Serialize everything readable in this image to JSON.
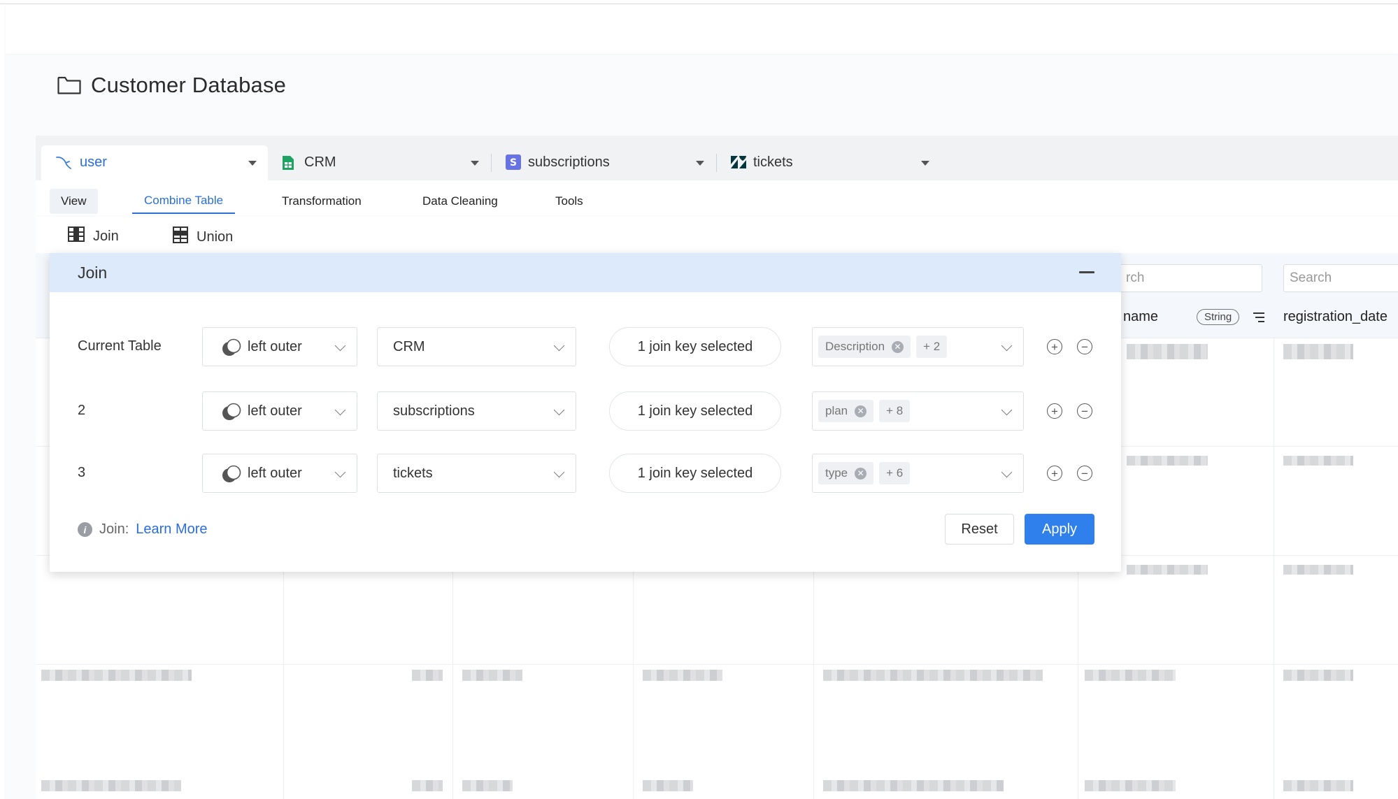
{
  "page": {
    "title": "Customer Database",
    "icon": "folder-icon"
  },
  "source_tabs": [
    {
      "label": "user",
      "icon": "mysql-icon",
      "active": true
    },
    {
      "label": "CRM",
      "icon": "google-sheets-icon",
      "active": false
    },
    {
      "label": "subscriptions",
      "icon": "stripe-icon",
      "active": false
    },
    {
      "label": "tickets",
      "icon": "zendesk-icon",
      "active": false
    }
  ],
  "menu_tabs": [
    {
      "label": "View"
    },
    {
      "label": "Combine Table",
      "active": true
    },
    {
      "label": "Transformation"
    },
    {
      "label": "Data Cleaning"
    },
    {
      "label": "Tools"
    }
  ],
  "tools": {
    "join_label": "Join",
    "union_label": "Union"
  },
  "grid": {
    "search_partial": "rch",
    "search_placeholder": "Search",
    "columns": [
      {
        "name": "name",
        "type_badge": "String"
      },
      {
        "name": "registration_date"
      }
    ]
  },
  "join_panel": {
    "title": "Join",
    "rows": [
      {
        "label": "Current Table",
        "join_type": "left outer",
        "table": "CRM",
        "keys": "1 join key selected",
        "first_column": "Description",
        "more_columns": "+ 2"
      },
      {
        "label": "2",
        "join_type": "left outer",
        "table": "subscriptions",
        "keys": "1 join key selected",
        "first_column": "plan",
        "more_columns": "+ 8"
      },
      {
        "label": "3",
        "join_type": "left outer",
        "table": "tickets",
        "keys": "1 join key selected",
        "first_column": "type",
        "more_columns": "+ 6"
      }
    ],
    "footer_prefix": "Join:",
    "learn_more": "Learn More",
    "reset_label": "Reset",
    "apply_label": "Apply"
  },
  "colors": {
    "accent": "#2f80ed",
    "active_tab_text": "#2b6fd6",
    "panel_header": "#dceafb"
  }
}
